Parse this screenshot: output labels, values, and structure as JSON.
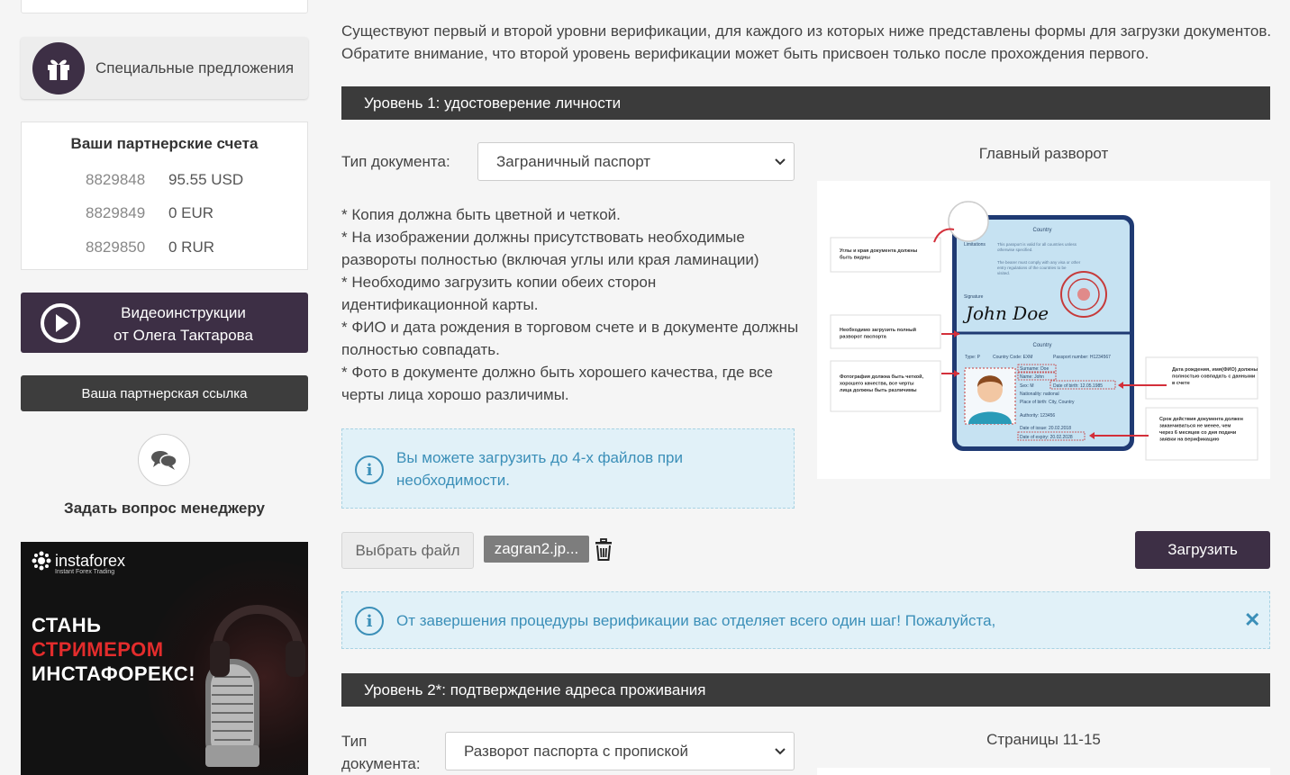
{
  "sidebar": {
    "special_offers": "Специальные предложения",
    "accounts_title": "Ваши партнерские счета",
    "accounts": [
      {
        "number": "8829848",
        "balance": "95.55 USD"
      },
      {
        "number": "8829849",
        "balance": "0 EUR"
      },
      {
        "number": "8829850",
        "balance": "0 RUR"
      }
    ],
    "video_line1": "Видеоинструкции",
    "video_line2": "от Олега Тактарова",
    "ref_link": "Ваша партнерская ссылка",
    "ask_manager": "Задать вопрос менеджеру",
    "banner": {
      "brand": "instaforex",
      "tagline": "Instant Forex Trading",
      "line1": "СТАНЬ",
      "line2": "СТРИМЕРОМ",
      "line3": "ИНСТАФОРЕКС!"
    }
  },
  "main": {
    "intro": "Существуют первый и второй уровни верификации, для каждого из которых ниже представлены формы для загрузки документов. Обратите внимание, что второй уровень верификации может быть присвоен только после прохождения первого.",
    "level1": {
      "title": "Уровень 1: удостоверение личности",
      "doc_type_label": "Тип документа:",
      "doc_type_value": "Заграничный паспорт",
      "requirements": [
        "* Копия должна быть цветной и четкой.",
        "* На изображении должны присутствовать необходимые развороты полностью (включая углы или края ламинации)",
        "* Необходимо загрузить копии обеих сторон идентификационной карты.",
        "* ФИО и дата рождения в торговом счете и в документе должны полностью совпадать.",
        "* Фото в документе должно быть хорошего качества, где все черты лица хорошо различимы."
      ],
      "upload_info": "Вы можете загрузить до 4-х файлов при необходимости.",
      "choose_file": "Выбрать файл",
      "file_name": "zagran2.jp...",
      "upload_button": "Загрузить",
      "image_title": "Главный разворот",
      "passport": {
        "country": "Country",
        "limitations": "Limitations",
        "valid_text": "This passport is valid for all countries unless otherwise specified.",
        "bearer_text": "The bearer must comply with any visa or other entry regulations of the countries to be visited.",
        "signature_label": "Signature",
        "signature": "John Doe",
        "country2": "Country",
        "type": "Type: P",
        "country_code": "Country Code: EXM",
        "passport_number": "Passport number: H1234567",
        "surname": "Surname: Doe",
        "name": "Name: John",
        "sex": "Sex: M",
        "dob": "Date of birth: 12.05.1985",
        "nationality": "Nationality: national",
        "pob": "Place of birth: City, Country",
        "authority": "Authority: 123456",
        "issue": "Date of issue: 20.02.2018",
        "expiry": "Date of expiry: 20.02.2028",
        "note_corners": "Углы и края документа должны быть видны",
        "note_full": "Необходимо загрузить полный разворот паспорта",
        "note_photo": "Фотография должна быть четкой, хорошего качества, все черты лица должны быть различимы",
        "note_dob": "Дата рождения, имя(ФИО) должны полностью совпадать с данными в счете",
        "note_expiry": "Срок действия документа должен заканчиваться не менее, чем через 6 месяцев со дня подачи заявки на верификацию"
      }
    },
    "notice": "От завершения процедуры верификации вас отделяет всего один шаг! Пожалуйста,",
    "level2": {
      "title": "Уровень 2*: подтверждение адреса проживания",
      "doc_type_label": "Тип документа:",
      "doc_type_value": "Разворот паспорта с пропиской",
      "image_title": "Страницы 11-15"
    }
  },
  "colors": {
    "brand_purple": "#3d2f45",
    "section_dark": "#3b3b3b",
    "info_bg": "#e1f1f8",
    "info_text": "#3b8fb8",
    "alert_red": "#d32f3a"
  }
}
